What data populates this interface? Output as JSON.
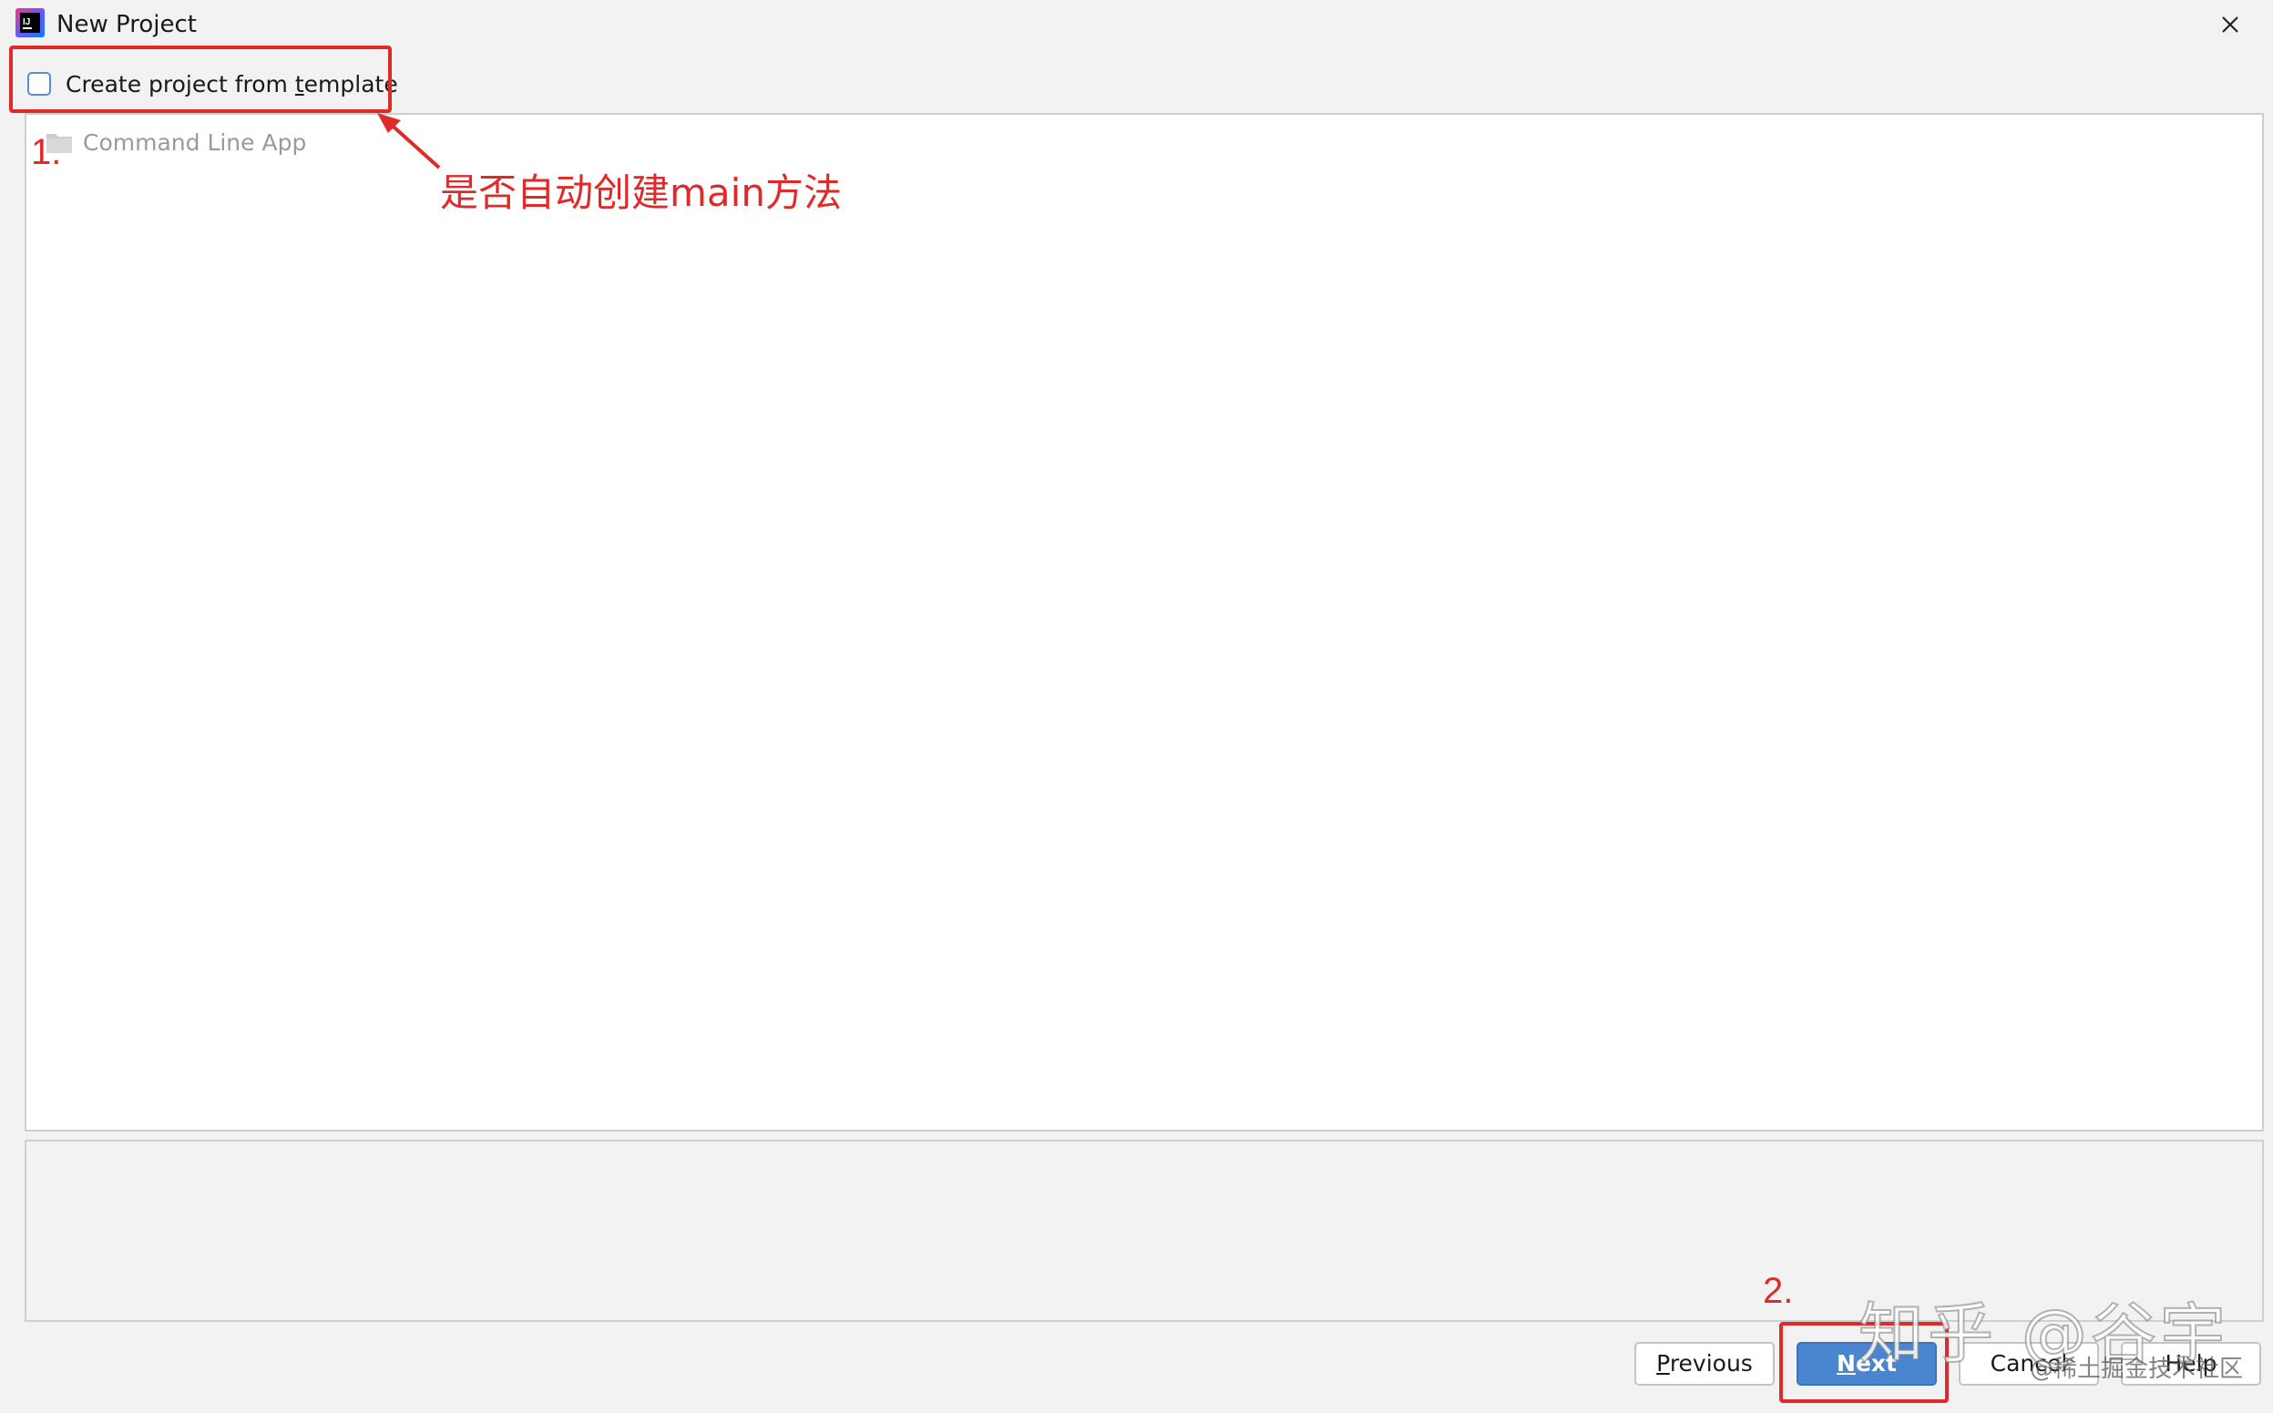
{
  "window": {
    "title": "New Project"
  },
  "template_option": {
    "label_before": "Create project from ",
    "label_mnemonic": "t",
    "label_after": "emplate",
    "checked": false
  },
  "project_list": {
    "items": [
      {
        "label": "Command Line App",
        "icon": "folder-icon"
      }
    ]
  },
  "buttons": {
    "previous": {
      "mnemonic": "P",
      "rest": "revious"
    },
    "next": {
      "mnemonic": "N",
      "rest": "ext"
    },
    "cancel": {
      "label": "Cancel"
    },
    "help": {
      "label": "Help"
    }
  },
  "annotations": {
    "step1_number": "1.",
    "step1_note": "是否自动创建main方法",
    "step2_number": "2.",
    "color": "#e02a2a"
  },
  "watermarks": {
    "zhihu": "知乎 @谷宇",
    "juejin": "@稀土掘金技术社区"
  },
  "colors": {
    "accent": "#4a86d0",
    "annotation": "#e02a2a"
  }
}
